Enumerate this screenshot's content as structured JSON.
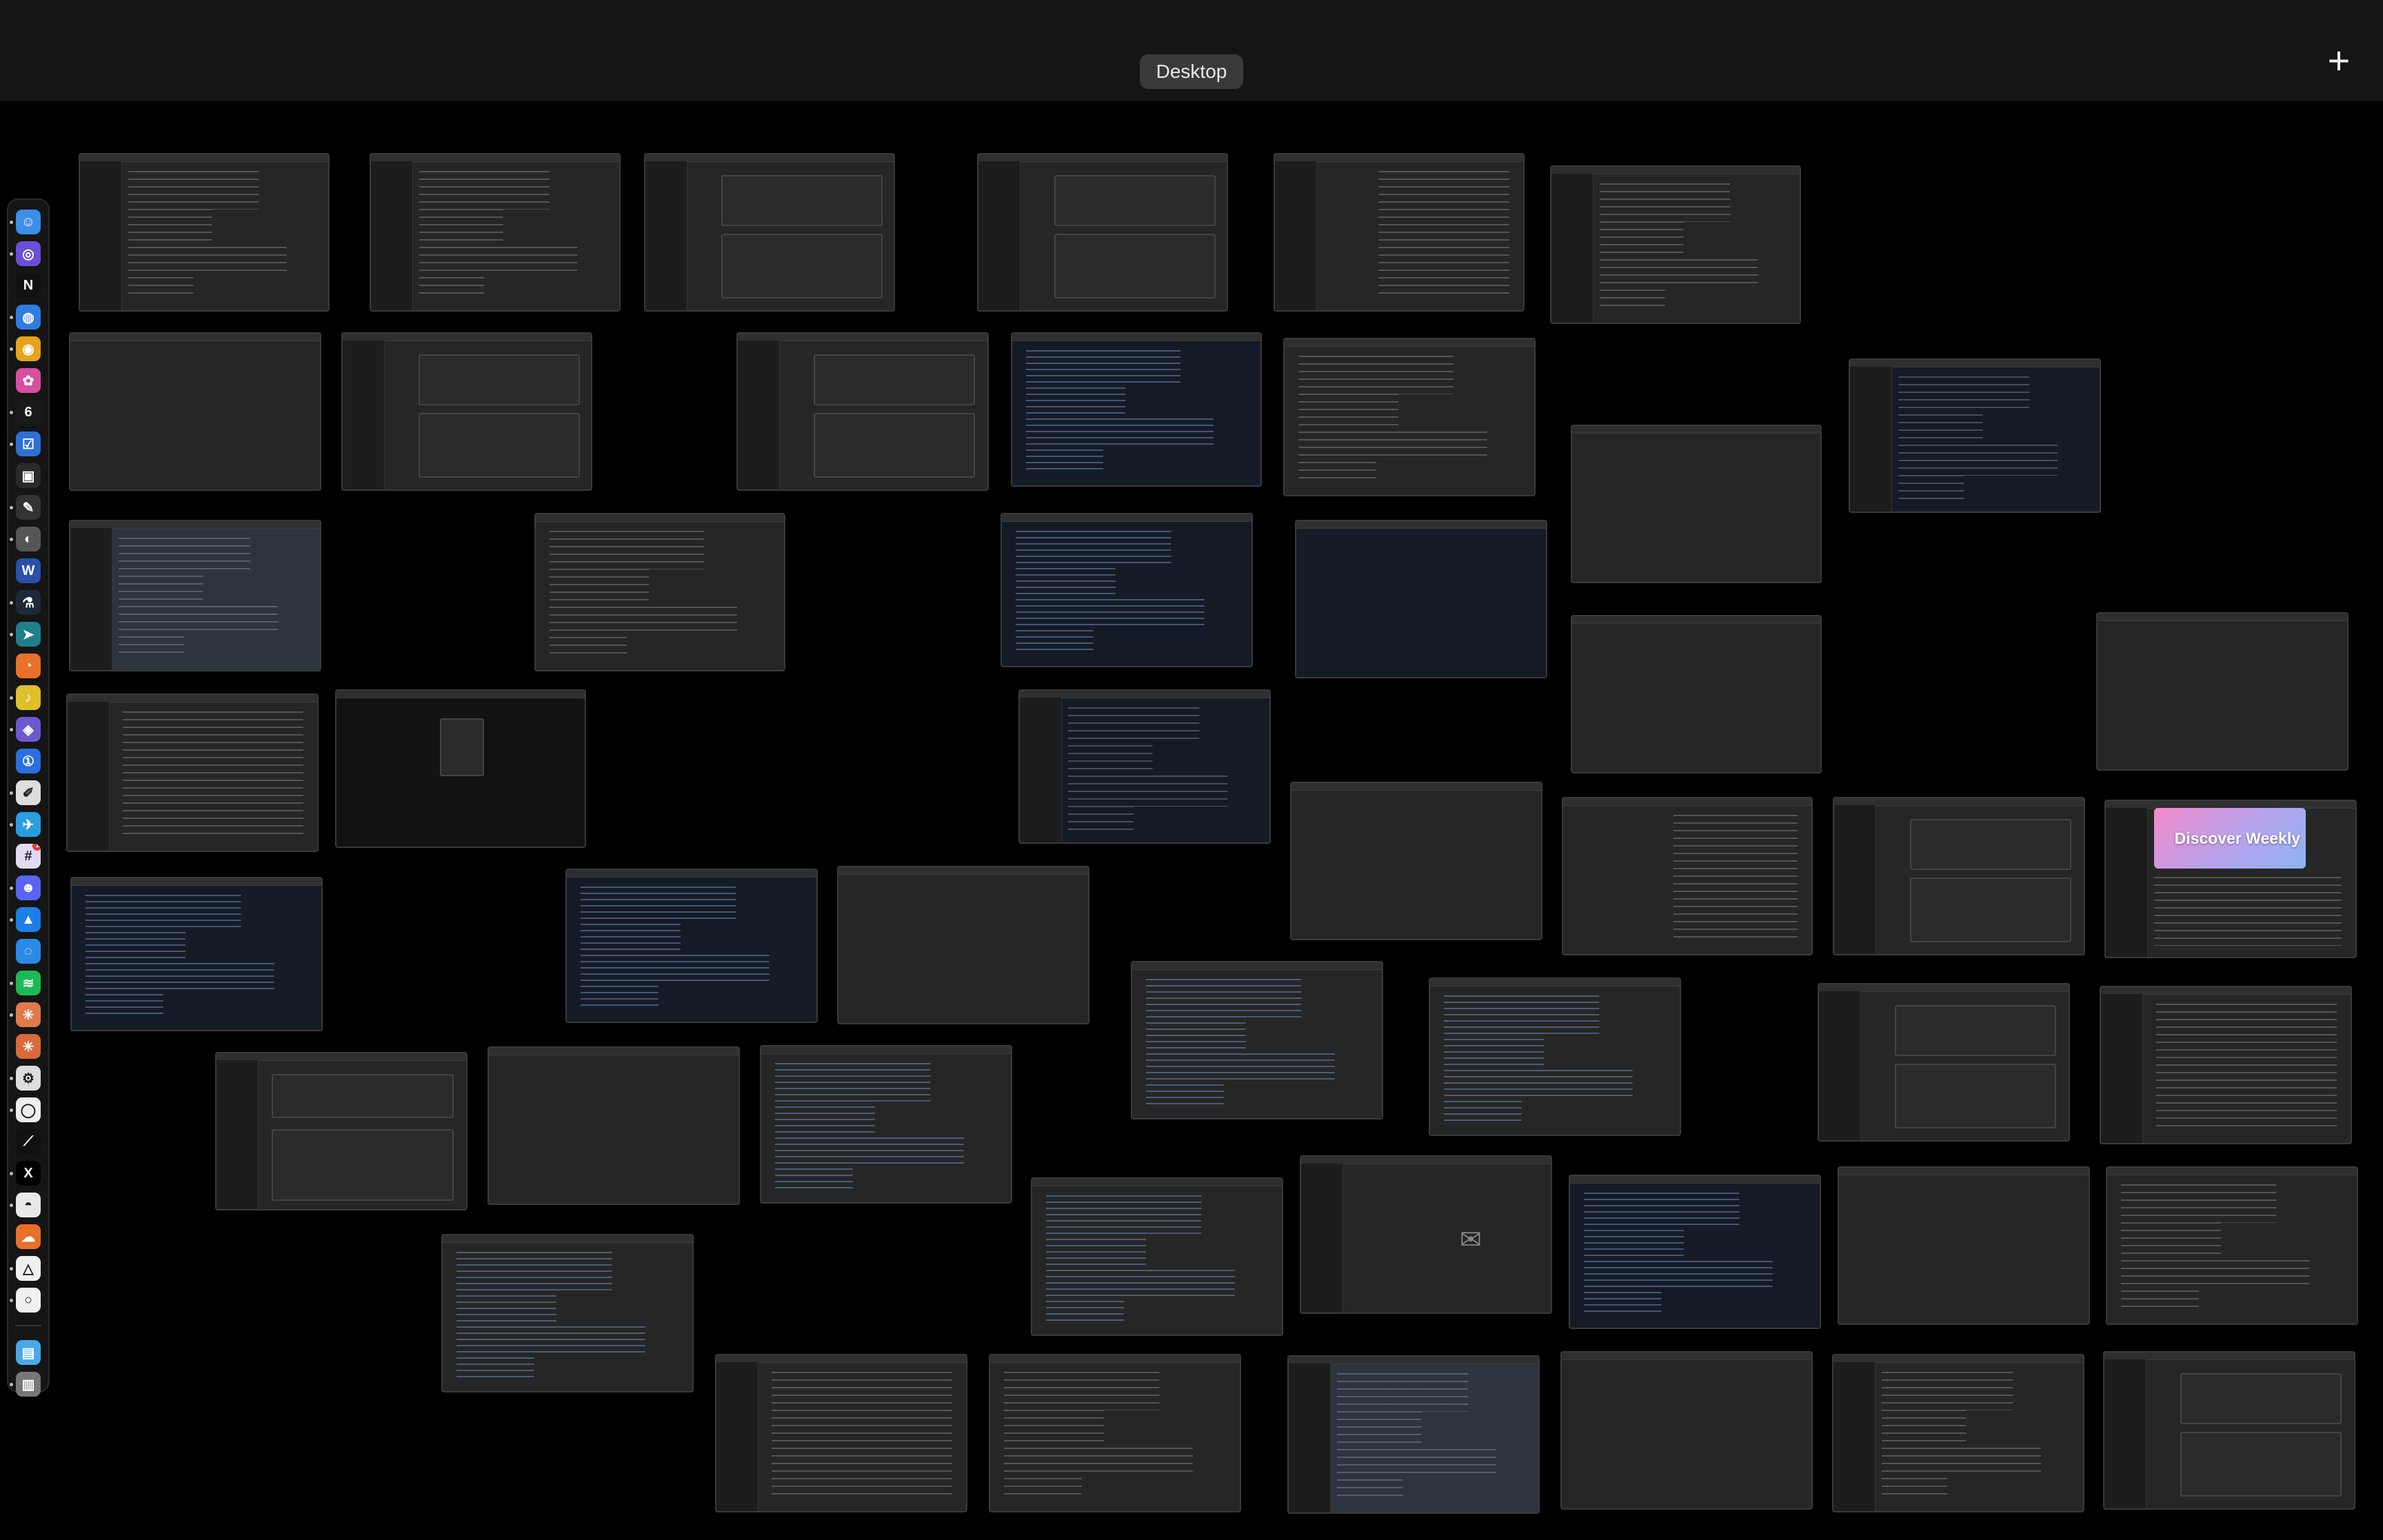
{
  "spaces_bar": {
    "current_space": "Desktop",
    "add_space_label": "+"
  },
  "dock": {
    "apps": [
      {
        "name": "finder-icon",
        "glyph": "☺",
        "color": "#3d8fe8",
        "badge": ""
      },
      {
        "name": "arc-browser-icon",
        "glyph": "◎",
        "color": "#6a4fd8",
        "badge": ""
      },
      {
        "name": "notion-icon",
        "glyph": "N",
        "color": "#111111",
        "badge": ""
      },
      {
        "name": "safari-icon",
        "glyph": "◍",
        "color": "#2e7de0",
        "badge": ""
      },
      {
        "name": "chrome-icon",
        "glyph": "◉",
        "color": "#e6a21a",
        "badge": ""
      },
      {
        "name": "photos-icon",
        "glyph": "✿",
        "color": "#d64fa0",
        "badge": ""
      },
      {
        "name": "calendar-icon",
        "glyph": "6",
        "color": "#1a1a1a",
        "badge": ""
      },
      {
        "name": "tasks-icon",
        "glyph": "☑",
        "color": "#2f6fd6",
        "badge": ""
      },
      {
        "name": "cube-app-icon",
        "glyph": "▣",
        "color": "#2a2a2a",
        "badge": ""
      },
      {
        "name": "pen-tool-icon",
        "glyph": "✎",
        "color": "#333333",
        "badge": ""
      },
      {
        "name": "sphere-app-icon",
        "glyph": "◐",
        "color": "#555555",
        "badge": ""
      },
      {
        "name": "word-icon",
        "glyph": "W",
        "color": "#2a4fa8",
        "badge": ""
      },
      {
        "name": "flask-icon",
        "glyph": "⚗",
        "color": "#1d2a3a",
        "badge": ""
      },
      {
        "name": "send-icon",
        "glyph": "➤",
        "color": "#20808a",
        "badge": ""
      },
      {
        "name": "reeder-icon",
        "glyph": "◔",
        "color": "#e8702a",
        "badge": ""
      },
      {
        "name": "scrobbles-icon",
        "glyph": "♪",
        "color": "#e0c02a",
        "badge": ""
      },
      {
        "name": "vpn-icon",
        "glyph": "◈",
        "color": "#6a5acd",
        "badge": ""
      },
      {
        "name": "1password-icon",
        "glyph": "①",
        "color": "#2a6fe0",
        "badge": ""
      },
      {
        "name": "notes-icon",
        "glyph": "✐",
        "color": "#dddddd",
        "badge": ""
      },
      {
        "name": "telegram-icon",
        "glyph": "✈",
        "color": "#2a9de0",
        "badge": ""
      },
      {
        "name": "slack-icon",
        "glyph": "#",
        "color": "#e3d9f0",
        "badge": "1"
      },
      {
        "name": "discord-icon",
        "glyph": "☻",
        "color": "#5865f2",
        "badge": ""
      },
      {
        "name": "testflight-icon",
        "glyph": "▲",
        "color": "#1c7fe8",
        "badge": ""
      },
      {
        "name": "globe-app-icon",
        "glyph": "◌",
        "color": "#2a8ae8",
        "badge": ""
      },
      {
        "name": "spotify-icon",
        "glyph": "≋",
        "color": "#1db954",
        "badge": ""
      },
      {
        "name": "claude-icon",
        "glyph": "✳",
        "color": "#e07a4a",
        "badge": ""
      },
      {
        "name": "claude-code-icon",
        "glyph": "✳",
        "color": "#d96a3a",
        "badge": ""
      },
      {
        "name": "chatgpt-icon",
        "glyph": "⚙",
        "color": "#dddddd",
        "badge": ""
      },
      {
        "name": "messages-icon",
        "glyph": "◯",
        "color": "#eeeeee",
        "badge": ""
      },
      {
        "name": "cursor-icon",
        "glyph": "⟋",
        "color": "#111111",
        "badge": ""
      },
      {
        "name": "x-icon",
        "glyph": "X",
        "color": "#000000",
        "badge": ""
      },
      {
        "name": "linear-icon",
        "glyph": "◓",
        "color": "#e8e8e8",
        "badge": ""
      },
      {
        "name": "cloud-app-icon",
        "glyph": "☁",
        "color": "#e8702a",
        "badge": ""
      },
      {
        "name": "mountain-app-icon",
        "glyph": "△",
        "color": "#f0f0f0",
        "badge": ""
      },
      {
        "name": "circle-app-icon",
        "glyph": "○",
        "color": "#f0f0f0",
        "badge": ""
      },
      {
        "name": "downloads-folder-icon",
        "glyph": "▤",
        "color": "#4aa8e8",
        "badge": ""
      },
      {
        "name": "trash-icon",
        "glyph": "▥",
        "color": "#777777",
        "badge": ""
      }
    ]
  },
  "thumbnails": {
    "spotify_banner": "Discover Weekly"
  }
}
